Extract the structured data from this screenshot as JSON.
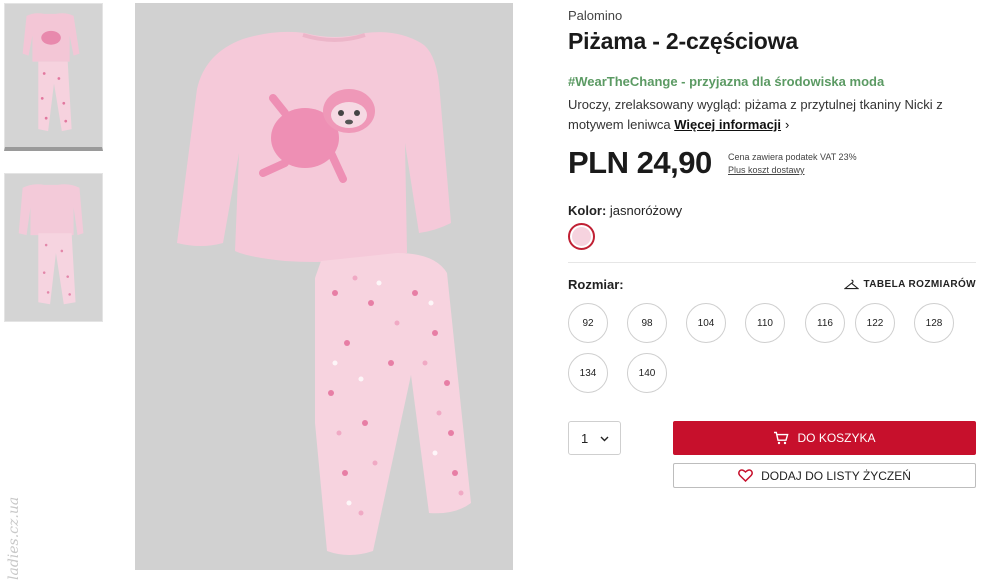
{
  "gallery": {
    "thumbnails": [
      {
        "alt": "pajama-front-thumbnail"
      },
      {
        "alt": "pajama-back-thumbnail"
      }
    ]
  },
  "watermark": {
    "text": "ladies.cz.ua"
  },
  "product": {
    "brand": "Palomino",
    "title": "Piżama - 2-częściowa",
    "eco_tag": "#WearTheChange - przyjazna dla środowiska moda",
    "description": "Uroczy, zrelaksowany wygląd: piżama z przytulnej tkaniny Nicki z motywem leniwca",
    "more_link": "Więcej informacji",
    "price": "PLN 24,90",
    "vat_note": "Cena zawiera podatek VAT 23%",
    "shipping_link": "Plus koszt dostawy",
    "color_label": "Kolor:",
    "color_value": "jasnoróżowy",
    "color_swatch": "#f6d3df",
    "size_label": "Rozmiar:",
    "size_table": "TABELA ROZMIARÓW",
    "sizes": [
      "92",
      "98",
      "104",
      "110",
      "116",
      "122",
      "128",
      "134",
      "140"
    ],
    "quantity": "1",
    "add_to_cart": "DO KOSZYKA",
    "add_to_wishlist": "DODAJ DO LISTY ŻYCZEŃ",
    "accent_color": "#c7102c",
    "eco_color": "#5b9a63"
  }
}
